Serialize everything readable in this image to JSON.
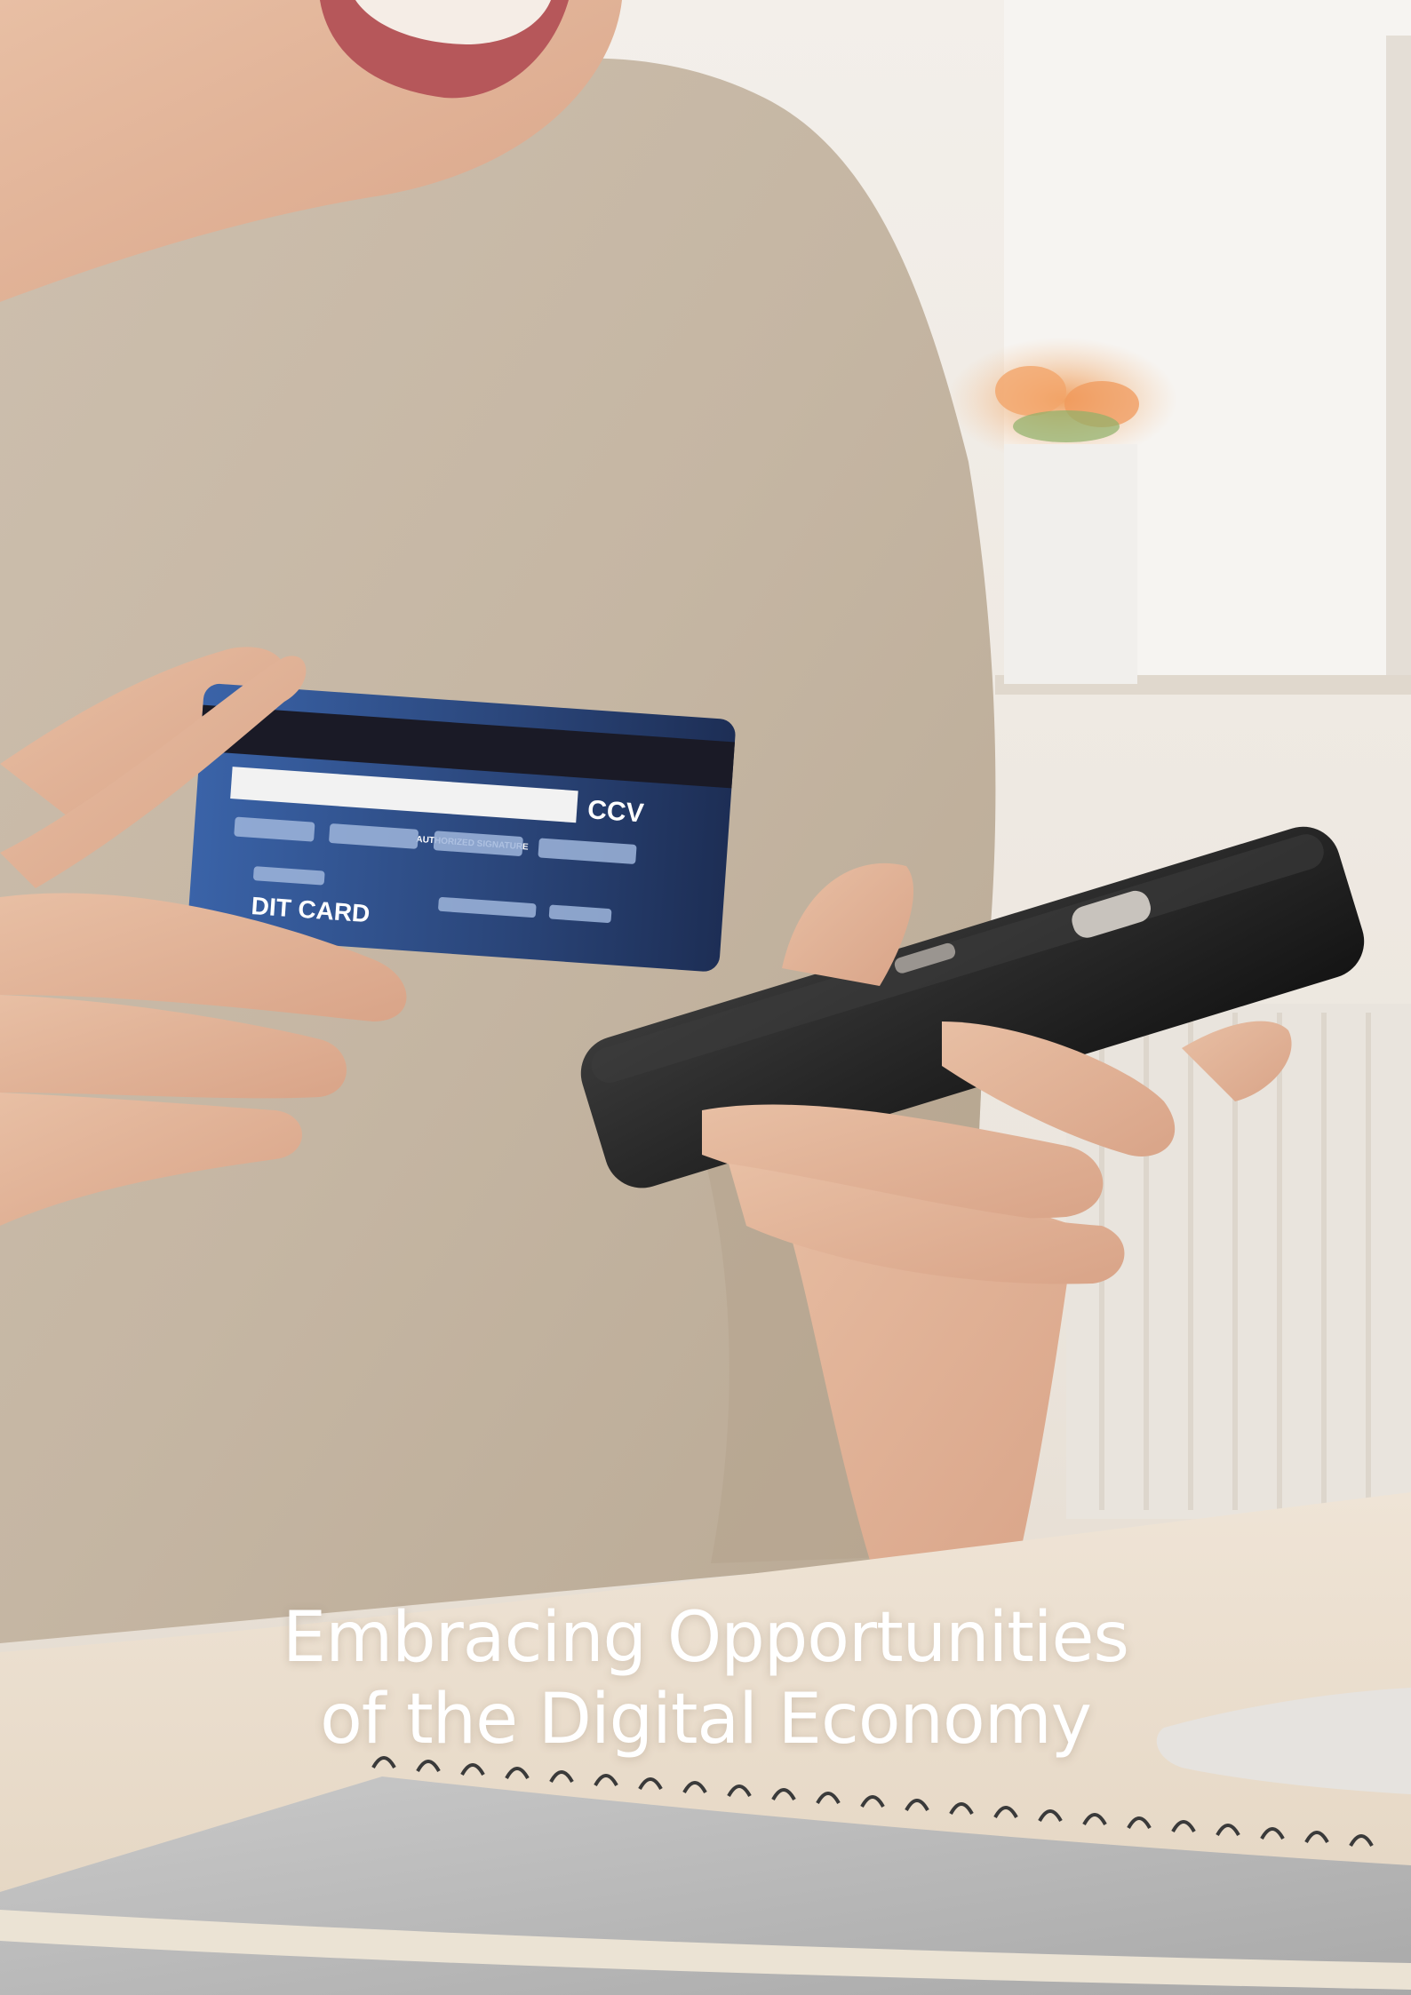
{
  "title": {
    "line1": "Embracing Opportunities",
    "line2": "of the Digital Economy"
  },
  "card": {
    "security_code_label": "CCV",
    "signature_label": "AUTHORIZED SIGNATURE",
    "type_label": "DIT CARD"
  },
  "colors": {
    "title": "#ffffff",
    "sweater": "#c8baa7",
    "card": "#2d4a82",
    "phone": "#1e1e1e",
    "background": "#efe9e1"
  }
}
